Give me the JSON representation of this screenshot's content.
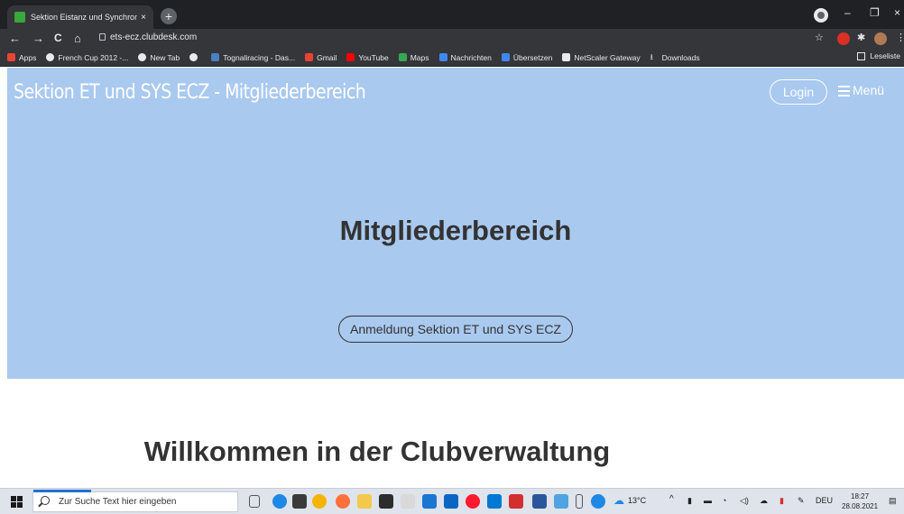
{
  "browser": {
    "tab_title": "Sektion Eistanz und Synchronized",
    "tab_close": "×",
    "new_tab": "+",
    "url": "ets-ecz.clubdesk.com",
    "window_controls": {
      "minimize": "–",
      "maximize": "❐",
      "close": "×"
    },
    "nav": {
      "back": "←",
      "forward": "→",
      "reload": "C",
      "home": "⌂"
    },
    "bookmarks": [
      {
        "label": "Apps",
        "icon": "apps-grid-icon",
        "color": "#ea4335"
      },
      {
        "label": "French Cup 2012 -...",
        "icon": "globe-icon",
        "color": "#e8eaed"
      },
      {
        "label": "New Tab",
        "icon": "globe-icon",
        "color": "#e8eaed"
      },
      {
        "label": "",
        "icon": "globe-icon",
        "color": "#e8eaed"
      },
      {
        "label": "Tognaliracing - Das...",
        "icon": "tognali-icon",
        "color": "#4a7fc1"
      },
      {
        "label": "Gmail",
        "icon": "gmail-icon",
        "color": "#ea4335"
      },
      {
        "label": "YouTube",
        "icon": "youtube-icon",
        "color": "#ff0000"
      },
      {
        "label": "Maps",
        "icon": "maps-icon",
        "color": "#34a853"
      },
      {
        "label": "Nachrichten",
        "icon": "news-icon",
        "color": "#4285f4"
      },
      {
        "label": "Übersetzen",
        "icon": "translate-icon",
        "color": "#4285f4"
      },
      {
        "label": "NetScaler Gateway",
        "icon": "netscaler-icon",
        "color": "#e8eaed"
      },
      {
        "label": "Downloads",
        "icon": "download-icon",
        "color": "#e8eaed"
      }
    ],
    "reading_list": "Leseliste"
  },
  "site": {
    "title": "Sektion ET und SYS ECZ - Mitgliederbereich",
    "login": "Login",
    "menu": "Menü",
    "hero_title": "Mitgliederbereich",
    "hero_button": "Anmeldung Sektion ET und SYS ECZ",
    "welcome": "Willkommen in der Clubverwaltung",
    "hero_color": "#a9c9ef"
  },
  "taskbar": {
    "search_placeholder": "Zur Suche Text hier eingeben",
    "weather": "13°C",
    "language": "DEU",
    "time": "18:27",
    "date": "28.08.2021"
  }
}
